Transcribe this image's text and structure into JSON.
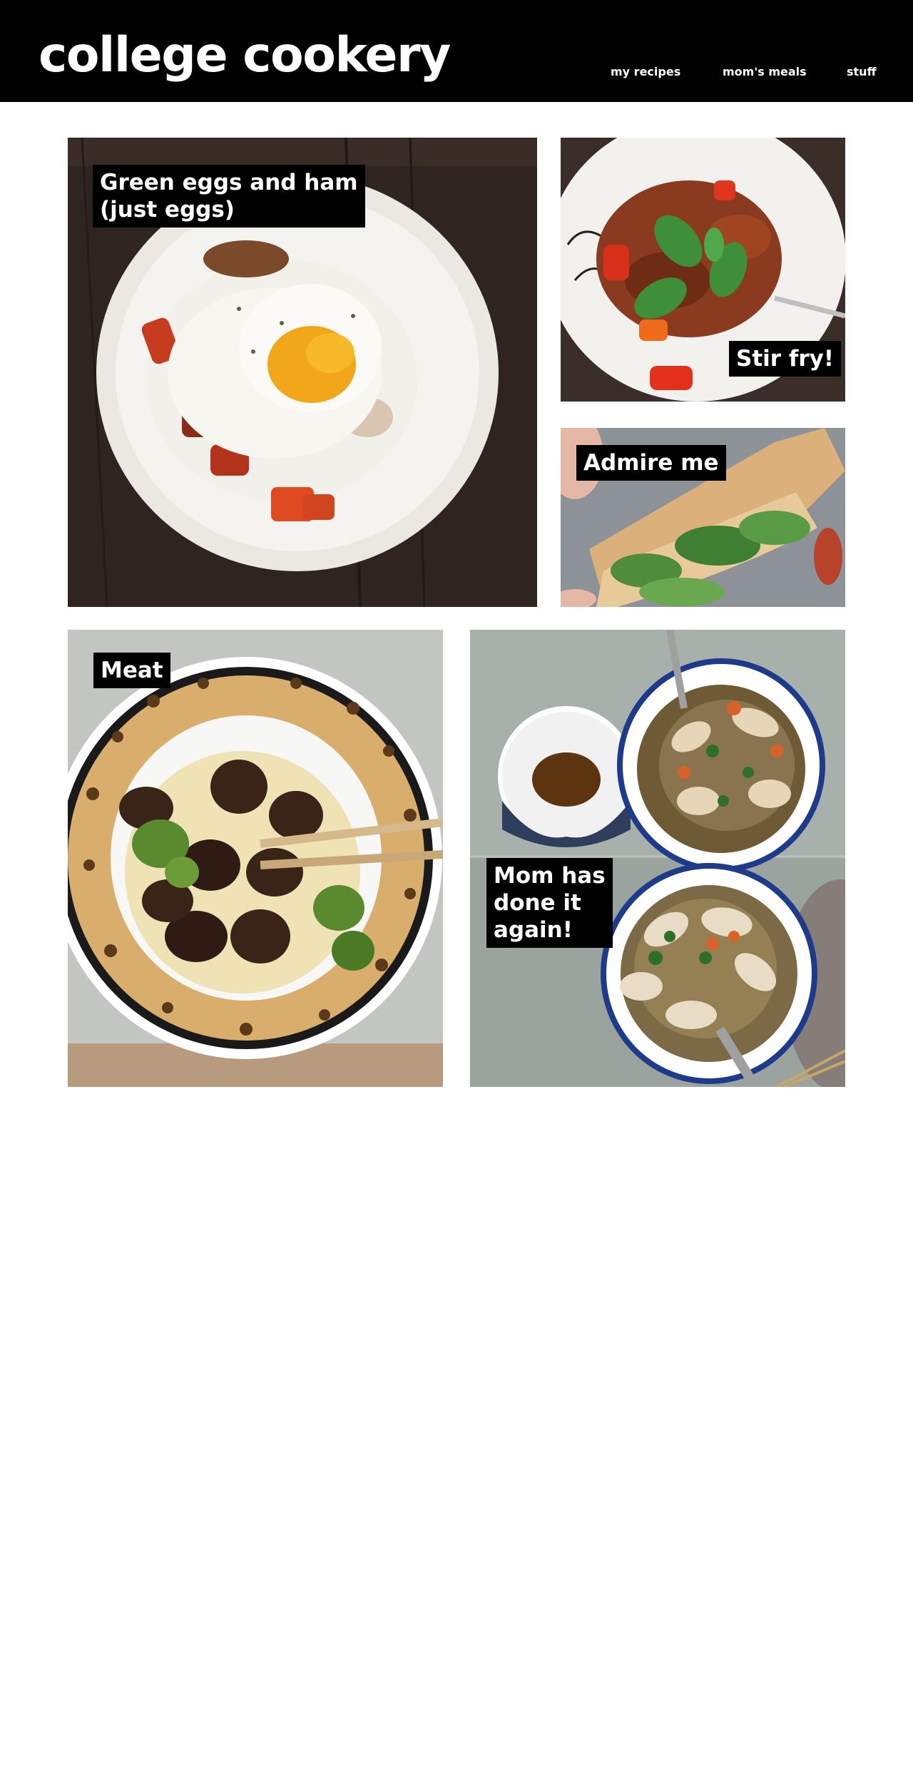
{
  "site": {
    "title": "college cookery",
    "nav": [
      "my recipes",
      "mom's meals",
      "stuff"
    ]
  },
  "gallery": [
    {
      "caption_lines": [
        "Green eggs and ham",
        "(just eggs)"
      ],
      "image": "fried egg over rice with peppers"
    },
    {
      "caption_lines": [
        "Stir fry!"
      ],
      "image": "stir fry with mint leaves"
    },
    {
      "caption_lines": [
        "Admire me"
      ],
      "image": "sandwich with greens"
    },
    {
      "caption_lines": [
        "Meat"
      ],
      "image": "beef and broccoli over noodles"
    },
    {
      "caption_lines": [
        "Mom has",
        "done it",
        "again!"
      ],
      "image": "crab noodle soup bowls"
    }
  ],
  "colors": {
    "header_bg": "#000000",
    "header_text": "#ffffff",
    "label_bg": "#000000",
    "label_text": "#ffffff"
  }
}
